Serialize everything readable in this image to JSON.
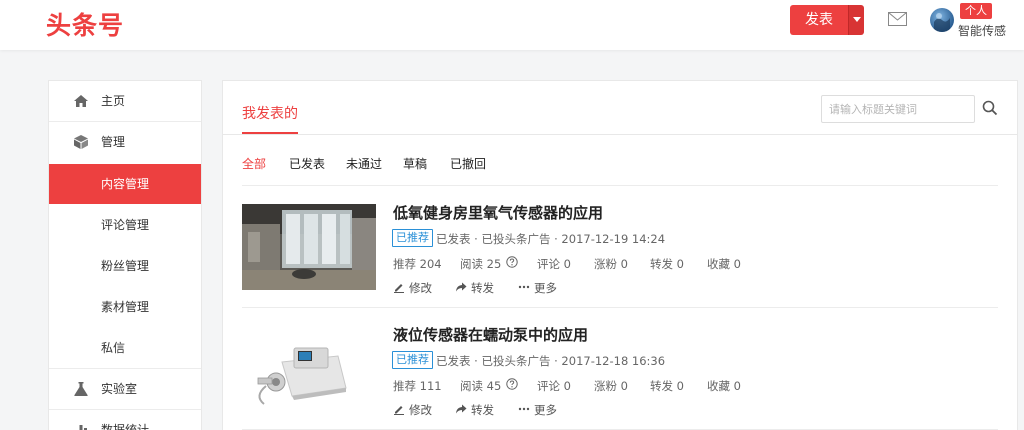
{
  "header": {
    "logo": "头条号",
    "publish_label": "发表",
    "badge": "个人",
    "user_name": "智能传感"
  },
  "sidebar": {
    "items": [
      {
        "label": "主页",
        "icon": "home-icon"
      },
      {
        "label": "管理",
        "icon": "box-icon"
      },
      {
        "label": "内容管理"
      },
      {
        "label": "评论管理"
      },
      {
        "label": "粉丝管理"
      },
      {
        "label": "素材管理"
      },
      {
        "label": "私信"
      },
      {
        "label": "实验室",
        "icon": "flask-icon"
      },
      {
        "label": "数据统计",
        "icon": "bar-chart-icon"
      }
    ],
    "active_index": 2
  },
  "main": {
    "tab": "我发表的",
    "search_placeholder": "请输入标题关键词",
    "filters": [
      "全部",
      "已发表",
      "未通过",
      "草稿",
      "已撤回"
    ],
    "active_filter": 0,
    "articles": [
      {
        "title": "低氧健身房里氧气传感器的应用",
        "tag": "已推荐",
        "status": "已发表 · 已投头条广告 · 2017-12-19 14:24",
        "recommend": "推荐 204",
        "read": "阅读 25",
        "comment": "评论 0",
        "fans": "涨粉 0",
        "share": "转发 0",
        "collect": "收藏 0",
        "edit": "修改",
        "forward": "转发",
        "more": "更多"
      },
      {
        "title": "液位传感器在蠕动泵中的应用",
        "tag": "已推荐",
        "status": "已发表 · 已投头条广告 · 2017-12-18 16:36",
        "recommend": "推荐 111",
        "read": "阅读 45",
        "comment": "评论 0",
        "fans": "涨粉 0",
        "share": "转发 0",
        "collect": "收藏 0",
        "edit": "修改",
        "forward": "转发",
        "more": "更多"
      }
    ]
  },
  "colors": {
    "accent": "#ed4040",
    "tag_blue": "#2a90d7"
  }
}
